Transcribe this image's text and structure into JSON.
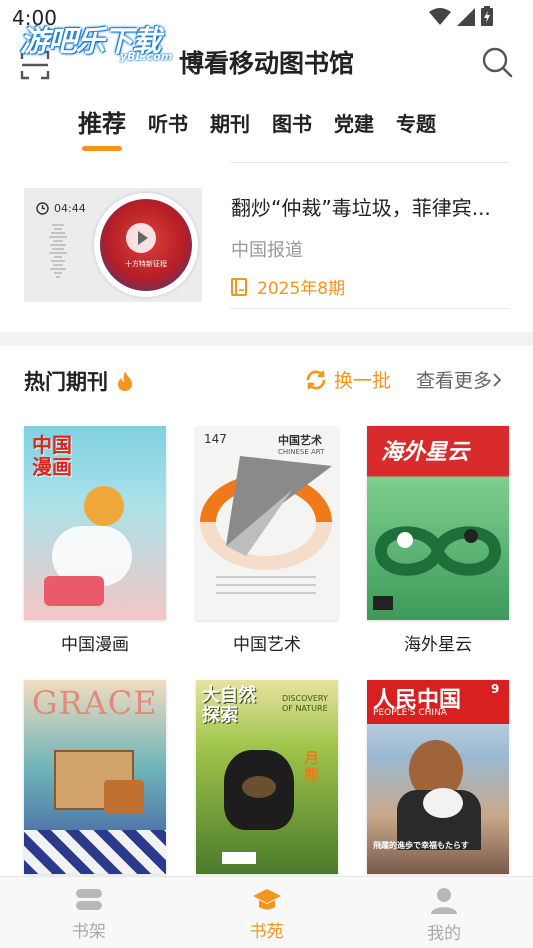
{
  "status": {
    "time": "4:00"
  },
  "watermark": {
    "text": "游吧乐下载",
    "sub": "yBL.com"
  },
  "header": {
    "title": "博看移动图书馆"
  },
  "tabs": [
    {
      "label": "推荐",
      "active": true
    },
    {
      "label": "听书"
    },
    {
      "label": "期刊"
    },
    {
      "label": "图书"
    },
    {
      "label": "党建"
    },
    {
      "label": "专题"
    }
  ],
  "audio_item": {
    "duration": "04:44",
    "title": "翻炒“仲裁”毒垃圾，菲律宾...",
    "source": "中国报道",
    "issue": "2025年8期",
    "cover_caption": "十方特新征程"
  },
  "hot_section": {
    "title": "热门期刊",
    "refresh_label": "换一批",
    "more_label": "查看更多",
    "magazines": [
      {
        "name": "中国漫画",
        "cover_text": "中国漫画"
      },
      {
        "name": "中国艺术",
        "cover_text": "中国艺术",
        "issue": "147",
        "sub": "CHINESE ART"
      },
      {
        "name": "海外星云",
        "cover_text": "海外星云"
      },
      {
        "name": "",
        "cover_text": "GRACE"
      },
      {
        "name": "",
        "cover_text": "大自然探索",
        "sub": "DISCOVERY OF NATURE",
        "badge": "月熊"
      },
      {
        "name": "",
        "cover_text": "人民中国",
        "sub": "PEOPLE'S CHINA",
        "issue": "9",
        "caption": "飛躍的進歩で幸福もたらす"
      }
    ]
  },
  "bottom_nav": [
    {
      "label": "书架"
    },
    {
      "label": "书苑",
      "active": true
    },
    {
      "label": "我的"
    }
  ],
  "colors": {
    "accent": "#f7941d"
  }
}
